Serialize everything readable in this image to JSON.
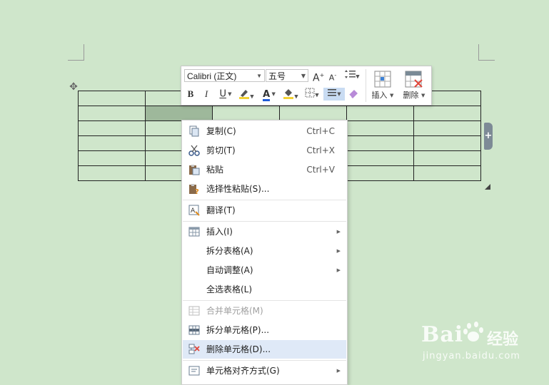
{
  "toolbar": {
    "font_name": "Calibri (正文)",
    "font_size": "五号",
    "grow_font": "A",
    "shrink_font": "A",
    "bold": "B",
    "italic": "I",
    "underline": "U",
    "font_color": "A",
    "insert_label": "插入",
    "delete_label": "删除",
    "accent_color": "#1f5bd8",
    "highlight_color": "#f3d234"
  },
  "context_menu": {
    "items": [
      {
        "label": "复制(C)",
        "shortcut": "Ctrl+C",
        "icon": "copy-icon"
      },
      {
        "label": "剪切(T)",
        "shortcut": "Ctrl+X",
        "icon": "scissors-icon"
      },
      {
        "label": "粘贴",
        "shortcut": "Ctrl+V",
        "icon": "paste-icon"
      },
      {
        "label": "选择性粘贴(S)...",
        "icon": "paste-special-icon"
      },
      {
        "label": "翻译(T)",
        "icon": "translate-icon"
      },
      {
        "label": "插入(I)",
        "icon": "table-insert-icon",
        "submenu": true
      },
      {
        "label": "拆分表格(A)",
        "submenu": true
      },
      {
        "label": "自动调整(A)",
        "submenu": true
      },
      {
        "label": "全选表格(L)"
      },
      {
        "label": "合并单元格(M)",
        "icon": "merge-cells-icon",
        "disabled": true
      },
      {
        "label": "拆分单元格(P)...",
        "icon": "split-cells-icon"
      },
      {
        "label": "删除单元格(D)...",
        "icon": "delete-cells-icon",
        "highlighted": true
      },
      {
        "label": "单元格对齐方式(G)",
        "icon": "cell-align-icon",
        "submenu": true
      }
    ]
  },
  "watermark": {
    "brand": "Bai",
    "brand2": "经验",
    "url": "jingyan.baidu.com"
  },
  "table": {
    "rows": 6,
    "cols": 6,
    "selected_cell": "row 2, col 2"
  }
}
